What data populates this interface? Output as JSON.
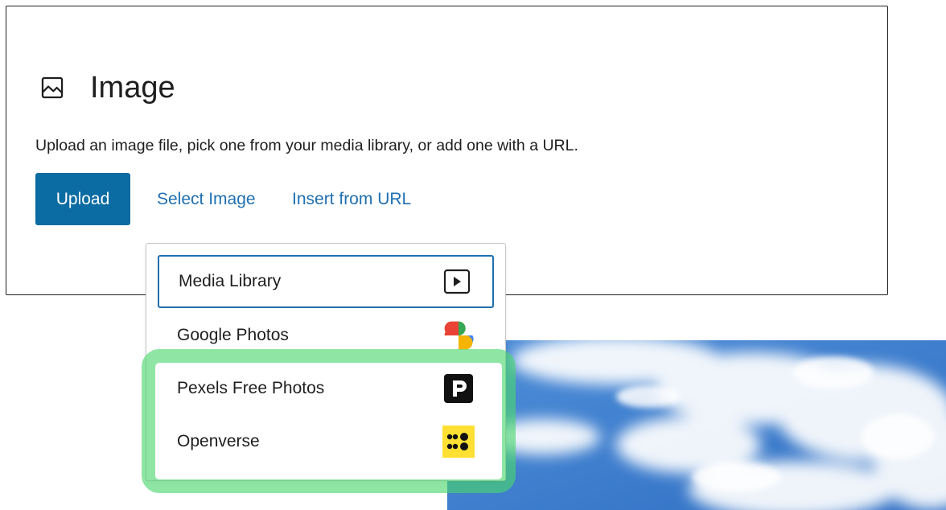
{
  "block": {
    "title": "Image",
    "icon": "image-icon",
    "instructions": "Upload an image file, pick one from your media library, or add one with a URL.",
    "upload_label": "Upload",
    "select_image_label": "Select Image",
    "insert_url_label": "Insert from URL"
  },
  "menu": {
    "items": [
      {
        "label": "Media Library",
        "icon": "media-library-icon"
      },
      {
        "label": "Google Photos",
        "icon": "google-photos-icon"
      },
      {
        "label": "Pexels Free Photos",
        "icon": "pexels-icon"
      },
      {
        "label": "Openverse",
        "icon": "openverse-icon"
      }
    ]
  },
  "colors": {
    "primary": "#0b6ba3",
    "link": "#1f6fb0",
    "highlight": "#4ad76c",
    "openverse_yellow": "#ffe033"
  }
}
